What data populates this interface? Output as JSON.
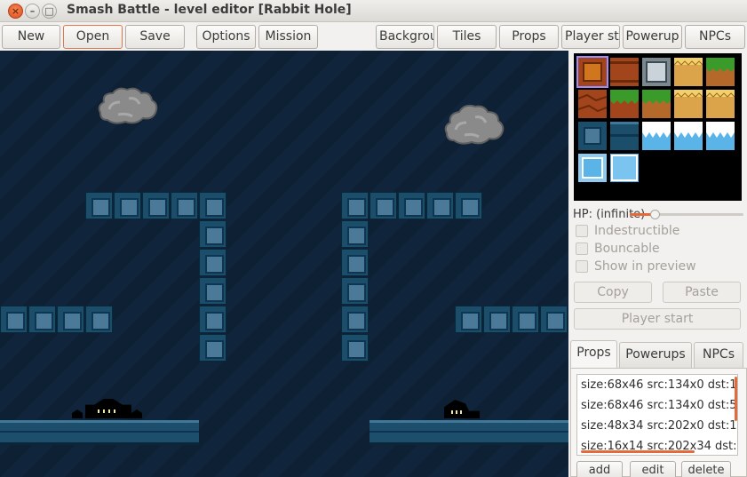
{
  "window": {
    "title": "Smash Battle - level editor [Rabbit Hole]",
    "controls": {
      "close": "×",
      "minimize": "–",
      "maximize": "□"
    }
  },
  "toolbar": {
    "new": "New",
    "open": "Open",
    "save": "Save",
    "options": "Options",
    "mission": "Mission",
    "background": "Backgrou",
    "tiles": "Tiles",
    "props": "Props",
    "player_start": "Player st",
    "powerups": "Powerup",
    "npcs": "NPCs"
  },
  "palette": {
    "selected_index": 0,
    "tiles": [
      "brick-crate-tile",
      "brick-wall-tile",
      "steel-block-tile",
      "sand-tile",
      "grass-tile",
      "rock-tile",
      "grass-rock-tile",
      "grass-tile-2",
      "sand-tile-2",
      "sand-tile-3",
      "blue-block-tile",
      "blue-panel-tile",
      "snow-tile",
      "snow-tile-2",
      "snow-tile-3",
      "ice-block-tile",
      "ice-block-tile-2"
    ]
  },
  "properties": {
    "hp_label": "HP: (infinite)",
    "hp_level_fraction": 0.0,
    "indestructible": "Indestructible",
    "bouncable": "Bouncable",
    "show_in_preview": "Show in preview",
    "copy": "Copy",
    "paste": "Paste",
    "player_start": "Player start"
  },
  "tabs": {
    "props": "Props",
    "powerups": "Powerups",
    "npcs": "NPCs"
  },
  "props_list": [
    "size:68x46 src:134x0 dst:1",
    "size:68x46 src:134x0 dst:5",
    "size:48x34 src:202x0 dst:1",
    "size:16x14 src:202x34 dst:"
  ],
  "list_buttons": {
    "add": "add",
    "edit": "edit",
    "delete": "delete"
  },
  "colors": {
    "accent": "#e46a3a",
    "canvas_bg": "#10253b",
    "block": "#1a4e6a"
  }
}
